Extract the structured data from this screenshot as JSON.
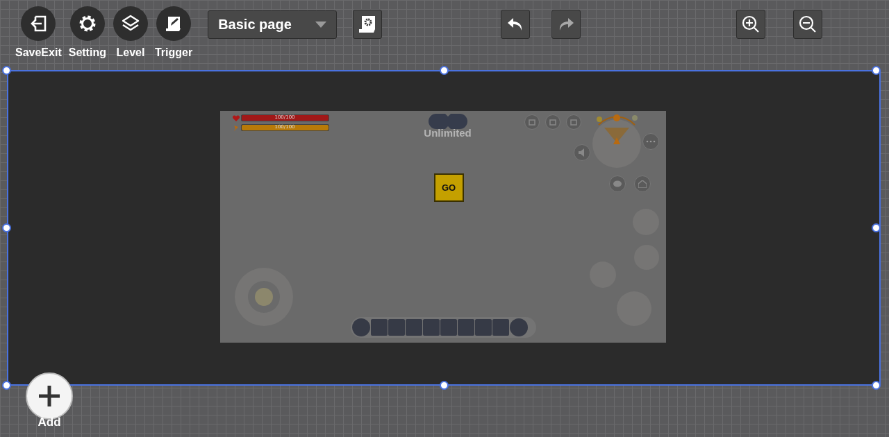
{
  "toolbar": {
    "tools": [
      {
        "kind": "exit",
        "label": "SaveExit"
      },
      {
        "kind": "gear",
        "label": "Setting"
      },
      {
        "kind": "layers",
        "label": "Level"
      },
      {
        "kind": "script",
        "label": "Trigger"
      }
    ],
    "page_select": {
      "value": "Basic page"
    },
    "undo": {
      "disabled": false
    },
    "redo": {
      "disabled": true
    }
  },
  "preview": {
    "health": {
      "reading": "100/100",
      "level": 1
    },
    "hunger": {
      "reading": "100/100",
      "level": 1
    },
    "mode": "Unlimited",
    "go_button": "GO"
  },
  "add_button": {
    "label": "Add"
  }
}
